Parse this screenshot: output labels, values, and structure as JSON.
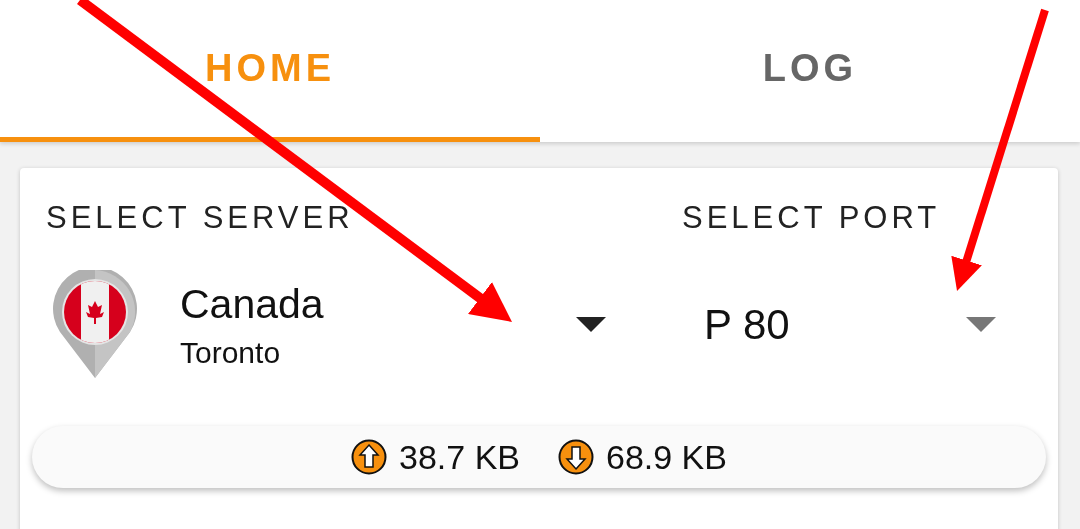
{
  "tabs": [
    {
      "label": "HOME",
      "selected": true
    },
    {
      "label": "LOG",
      "selected": false
    }
  ],
  "server_picker": {
    "label": "SELECT SERVER",
    "country": "Canada",
    "city": "Toronto"
  },
  "port_picker": {
    "label": "SELECT PORT",
    "value": "P 80"
  },
  "traffic": {
    "upload": "38.7 KB",
    "download": "68.9 KB"
  }
}
